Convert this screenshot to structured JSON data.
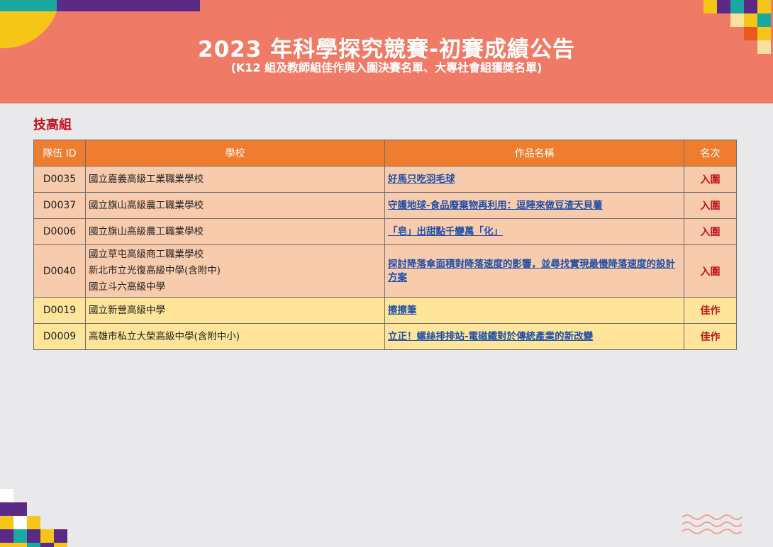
{
  "header": {
    "title": "2023 年科學探究競賽-初賽成績公告",
    "subtitle": "(K12 組及教師組佳作與入圍決賽名單、大專社會組獲獎名單)"
  },
  "section": {
    "title": "技高組"
  },
  "table": {
    "headers": [
      "隊伍 ID",
      "學校",
      "作品名稱",
      "名次"
    ],
    "rows": [
      {
        "id": "D0035",
        "schools": [
          "國立嘉義高級工業職業學校"
        ],
        "work": "好馬只吃羽毛球",
        "rank": "入圍",
        "tier": "finalist"
      },
      {
        "id": "D0037",
        "schools": [
          "國立旗山高級農工職業學校"
        ],
        "work": "守護地球-食品廢棄物再利用：逗陣來做豆渣天貝薯",
        "rank": "入圍",
        "tier": "finalist"
      },
      {
        "id": "D0006",
        "schools": [
          "國立旗山高級農工職業學校"
        ],
        "work": "「皂」出甜點千變萬「化」",
        "rank": "入圍",
        "tier": "finalist"
      },
      {
        "id": "D0040",
        "schools": [
          "國立草屯高級商工職業學校",
          "新北市立光復高級中學(含附中)",
          "國立斗六高級中學"
        ],
        "work": "探討降落傘面積對降落速度的影響，並尋找實現最慢降落速度的設計方案",
        "rank": "入圍",
        "tier": "finalist"
      },
      {
        "id": "D0019",
        "schools": [
          "國立新營高級中學"
        ],
        "work": "擦擦筆",
        "rank": "佳作",
        "tier": "honor"
      },
      {
        "id": "D0009",
        "schools": [
          "高雄市私立大榮高級中學(含附中小)"
        ],
        "work": "立正！螺絲排排站-電磁鐵對於傳統產業的新改變",
        "rank": "佳作",
        "tier": "honor"
      }
    ]
  },
  "colors": {
    "banner": "#ef7b66",
    "header_row": "#ee7d2f",
    "finalist_row": "#f8cbad",
    "honor_row": "#fee599",
    "rank_text": "#c0121e",
    "work_link": "#1f4fa8"
  }
}
